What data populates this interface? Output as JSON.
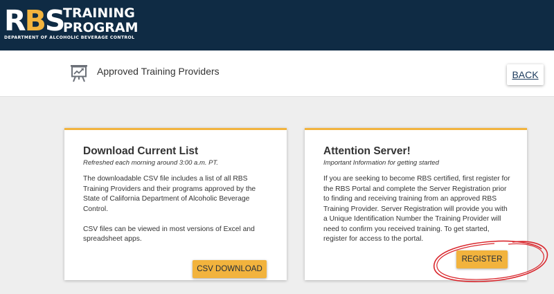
{
  "header": {
    "logo_rbs_r": "R",
    "logo_rbs_b": "B",
    "logo_rbs_s": "S",
    "logo_line1": "TRAINING",
    "logo_line2": "PROGRAM",
    "logo_dept": "DEPARTMENT OF ALCOHOLIC BEVERAGE CONTROL"
  },
  "subbar": {
    "title": "Approved Training Providers",
    "icon": "presentation-chart-icon",
    "back_label": "BACK"
  },
  "download_card": {
    "title": "Download Current List",
    "subtitle": "Refreshed each morning around 3:00 a.m. PT.",
    "body1": "The downloadable CSV file includes a list of all RBS Training Providers and their programs approved by the State of California Department of Alcoholic Beverage Control.",
    "body2": "CSV files can be viewed in most versions of Excel and spreadsheet apps.",
    "button_label": "CSV DOWNLOAD"
  },
  "server_card": {
    "title": "Attention Server!",
    "subtitle": "Important Information for getting started",
    "body": "If you are seeking to become RBS certified, first register for the RBS Portal and complete the Server Registration prior to finding and receiving training from an approved RBS Training Provider. Server Registration will provide you with a Unique Identification Number the Training Provider will need to confirm you received training. To get started, register for access to the portal.",
    "button_label": "REGISTER"
  },
  "colors": {
    "header_bg": "#0f2b44",
    "accent": "#f2b33d",
    "annotation": "#d9262c"
  }
}
